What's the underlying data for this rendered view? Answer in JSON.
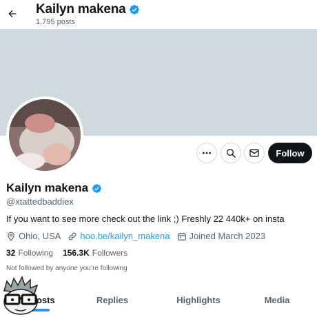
{
  "header": {
    "display_name": "Kailyn makena",
    "posts_count": "1,795 posts"
  },
  "actions": {
    "follow_label": "Follow"
  },
  "profile": {
    "display_name": "Kailyn makena",
    "handle": "@xtattedbaddiex",
    "bio": "If you want to see more check out the link ;) Freshly 22 440k+ on insta",
    "location": "Ohio, USA",
    "link": "hoo.be/kailyn_makena",
    "joined": "Joined March 2023",
    "following_count": "32",
    "following_label": "Following",
    "followers_count": "156.3K",
    "followers_label": "Followers",
    "followed_by": "Not followed by anyone you’re following"
  },
  "tabs": [
    {
      "label": "Posts"
    },
    {
      "label": "Replies"
    },
    {
      "label": "Highlights"
    },
    {
      "label": "Media"
    }
  ],
  "colors": {
    "accent": "#1d9bf0",
    "banner": "#cfd9de",
    "text_secondary": "#536471",
    "button_dark": "#0f1419"
  },
  "icons": {
    "back": "arrow-left-icon",
    "verified": "verified-badge-icon",
    "more": "more-horizontal-icon",
    "search": "search-icon",
    "message": "envelope-icon",
    "location": "location-pin-icon",
    "link": "link-icon",
    "calendar": "calendar-icon"
  }
}
